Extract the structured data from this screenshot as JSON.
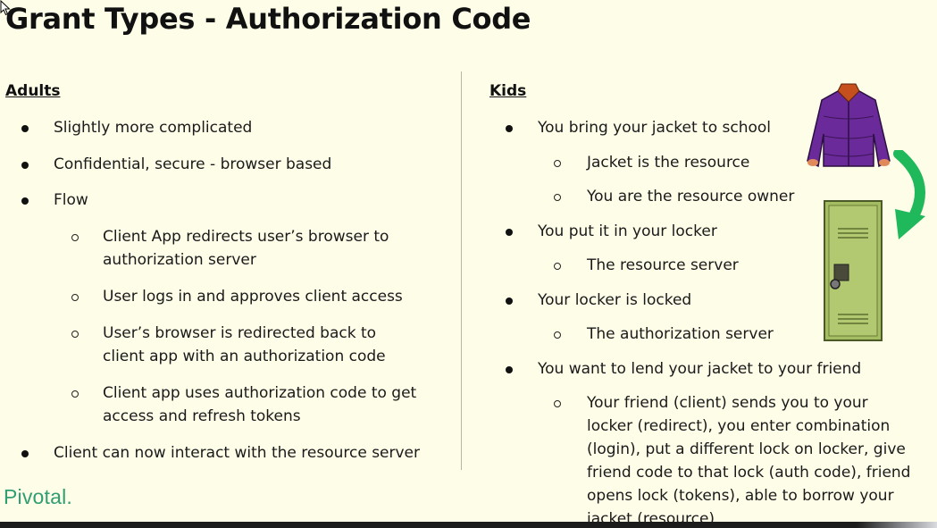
{
  "slide": {
    "title": "Grant Types - Authorization Code",
    "logo_text": "Pivotal."
  },
  "adults": {
    "heading": "Adults",
    "items": [
      {
        "level": 1,
        "lines": [
          "Slightly more complicated"
        ]
      },
      {
        "level": 1,
        "lines": [
          "Confidential, secure - browser based"
        ]
      },
      {
        "level": 1,
        "lines": [
          "Flow"
        ]
      },
      {
        "level": 2,
        "lines": [
          "Client App redirects user’s browser to",
          "authorization server"
        ]
      },
      {
        "level": 2,
        "lines": [
          "User logs in and approves client access"
        ]
      },
      {
        "level": 2,
        "lines": [
          "User’s browser is redirected back to",
          "client app with an authorization code"
        ]
      },
      {
        "level": 2,
        "lines": [
          "Client app uses authorization code to get",
          "access and refresh tokens"
        ]
      },
      {
        "level": 1,
        "lines": [
          "Client can now interact with the resource server"
        ]
      }
    ]
  },
  "kids": {
    "heading": "Kids",
    "items": [
      {
        "level": 1,
        "lines": [
          "You bring your jacket to school"
        ]
      },
      {
        "level": 2,
        "lines": [
          "Jacket is the resource"
        ]
      },
      {
        "level": 2,
        "lines": [
          "You are the resource owner"
        ]
      },
      {
        "level": 1,
        "lines": [
          "You put it in your locker"
        ]
      },
      {
        "level": 2,
        "lines": [
          "The resource server"
        ]
      },
      {
        "level": 1,
        "lines": [
          "Your locker is locked"
        ]
      },
      {
        "level": 2,
        "lines": [
          "The authorization server"
        ]
      },
      {
        "level": 1,
        "lines": [
          "You want to lend your jacket to your friend"
        ]
      },
      {
        "level": 2,
        "lines": [
          "Your friend (client) sends you to your",
          "locker (redirect), you enter combination",
          "(login), put a different lock on locker, give",
          "friend code to that lock (auth code), friend",
          "opens lock (tokens), able to borrow your",
          "jacket (resource)"
        ]
      }
    ]
  },
  "illustrations": {
    "jacket": "jacket-icon",
    "arrow": "curved-arrow-icon",
    "locker": "locker-icon"
  },
  "colors": {
    "background": "#fefde8",
    "jacket": "#6b2a9a",
    "collar": "#c5501e",
    "arrow": "#1fb85a",
    "locker": "#a5bd62",
    "logo": "#2f9e72"
  }
}
